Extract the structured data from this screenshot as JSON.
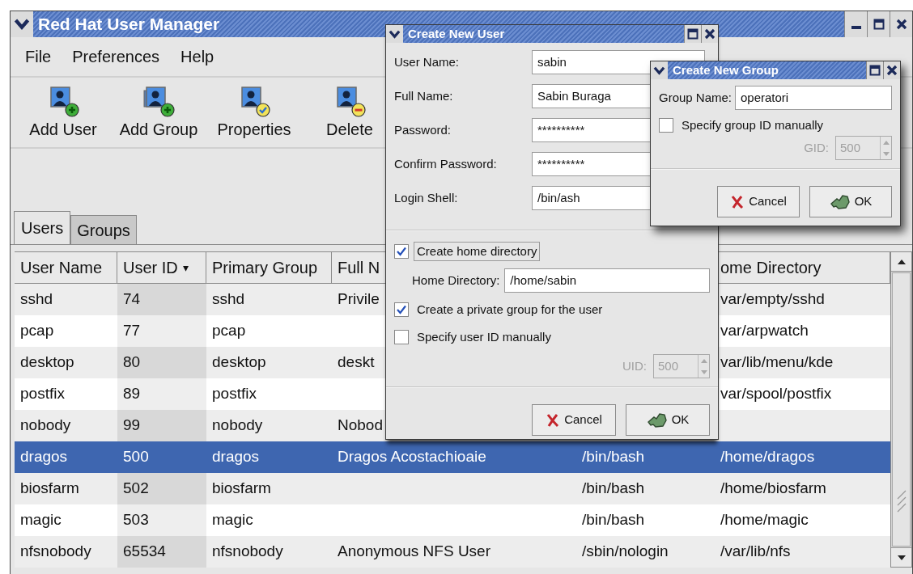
{
  "main_window": {
    "title": "Red Hat User Manager",
    "menu": [
      {
        "label": "File"
      },
      {
        "label": "Preferences"
      },
      {
        "label": "Help"
      }
    ],
    "toolbar": [
      {
        "label": "Add User",
        "kind": "add-user"
      },
      {
        "label": "Add Group",
        "kind": "add-group"
      },
      {
        "label": "Properties",
        "kind": "properties"
      },
      {
        "label": "Delete",
        "kind": "delete"
      }
    ],
    "tabs": [
      {
        "label": "Users",
        "selected": true
      },
      {
        "label": "Groups",
        "selected": false
      }
    ],
    "table": {
      "header": {
        "user_name": "User Name",
        "user_id": "User ID",
        "sort_indicator": "▾",
        "primary_group": "Primary Group",
        "full_name": "Full N",
        "home_directory": "ome Directory"
      },
      "rows": [
        {
          "user_name": "sshd",
          "user_id": "74",
          "primary_group": "sshd",
          "full_name": "Privile",
          "home_directory": "var/empty/sshd",
          "selected": false
        },
        {
          "user_name": "pcap",
          "user_id": "77",
          "primary_group": "pcap",
          "home_directory": "var/arpwatch",
          "selected": false
        },
        {
          "user_name": "desktop",
          "user_id": "80",
          "primary_group": "desktop",
          "full_name": "deskt",
          "home_directory": "var/lib/menu/kde",
          "selected": false
        },
        {
          "user_name": "postfix",
          "user_id": "89",
          "primary_group": "postfix",
          "home_directory": "var/spool/postfix",
          "selected": false
        },
        {
          "user_name": "nobody",
          "user_id": "99",
          "primary_group": "nobody",
          "full_name": "Nobod",
          "selected": false
        },
        {
          "user_name": "dragos",
          "user_id": "500",
          "primary_group": "dragos",
          "full_name": "Dragos Acostachioaie",
          "column_5": "/bin/bash",
          "home_directory": "/home/dragos",
          "selected": true
        },
        {
          "user_name": "biosfarm",
          "user_id": "502",
          "primary_group": "biosfarm",
          "column_5": "/bin/bash",
          "home_directory": "/home/biosfarm",
          "selected": false
        },
        {
          "user_name": "magic",
          "user_id": "503",
          "primary_group": "magic",
          "column_5": "/bin/bash",
          "home_directory": "/home/magic",
          "selected": false
        },
        {
          "user_name": "nfsnobody",
          "user_id": "65534",
          "primary_group": "nfsnobody",
          "full_name": "Anonymous NFS User",
          "column_5": "/sbin/nologin",
          "home_directory": "/var/lib/nfs",
          "selected": false
        }
      ]
    }
  },
  "user_dialog": {
    "title": "Create New User",
    "fields": [
      {
        "label": "User Name:",
        "value": "sabin"
      },
      {
        "label": "Full Name:",
        "value": "Sabin Buraga"
      },
      {
        "label": "Password:",
        "value": "**********"
      },
      {
        "label": "Confirm Password:",
        "value": "**********"
      },
      {
        "label": "Login Shell:",
        "value": "/bin/ash"
      }
    ],
    "options": [
      {
        "kind": "checkbox",
        "label": "Create home directory",
        "checked": true,
        "focused": true
      },
      {
        "kind": "field",
        "label": "Home Directory:",
        "value": "/home/sabin"
      },
      {
        "kind": "checkbox",
        "label": "Create a private group for the user",
        "checked": true,
        "focused": false
      },
      {
        "kind": "checkbox",
        "label": "Specify user ID manually",
        "checked": false,
        "focused": false
      },
      {
        "kind": "spin",
        "label": "UID:",
        "value": "500",
        "disabled": true
      }
    ],
    "buttons": [
      {
        "label": "Cancel",
        "kind": "cancel"
      },
      {
        "label": "OK",
        "kind": "ok"
      }
    ]
  },
  "group_dialog": {
    "title": "Create New Group",
    "fields": [
      {
        "label": "Group Name:",
        "value": "operatori"
      }
    ],
    "options": [
      {
        "kind": "checkbox",
        "label": "Specify group ID manually",
        "checked": false,
        "focused": false
      },
      {
        "kind": "spin",
        "label": "GID:",
        "value": "500",
        "disabled": true
      }
    ],
    "buttons": [
      {
        "label": "Cancel",
        "kind": "cancel"
      },
      {
        "label": "OK",
        "kind": "ok"
      }
    ]
  }
}
